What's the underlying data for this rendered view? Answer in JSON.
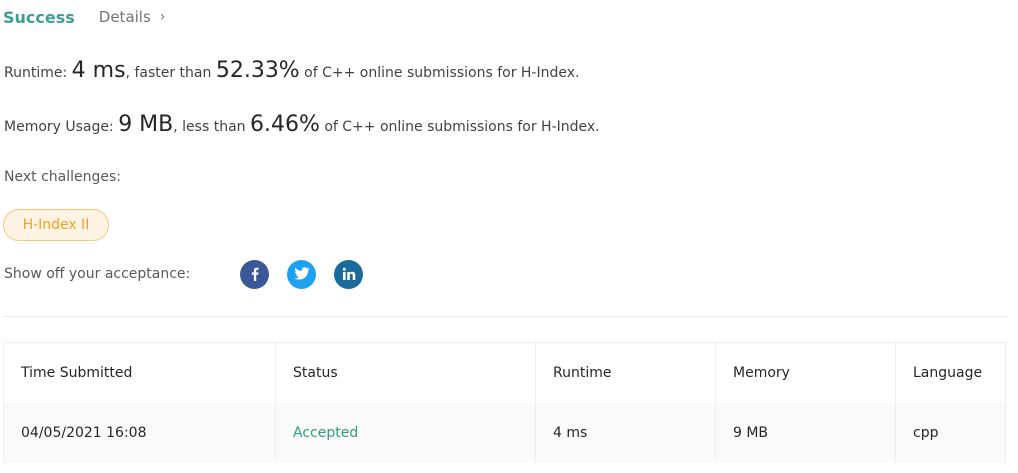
{
  "header": {
    "status": "Success",
    "details_label": "Details",
    "chevron": "›"
  },
  "runtime": {
    "label": "Runtime:",
    "value": "4 ms",
    "comparison": ", faster than",
    "percent": "52.33%",
    "suffix": "of C++ online submissions for H-Index."
  },
  "memory": {
    "label": "Memory Usage:",
    "value": "9 MB",
    "comparison": ", less than",
    "percent": "6.46%",
    "suffix": "of C++ online submissions for H-Index."
  },
  "next_challenges": {
    "label": "Next challenges:",
    "items": [
      "H-Index II"
    ]
  },
  "share": {
    "label": "Show off your acceptance:",
    "icons": [
      "facebook-icon",
      "twitter-icon",
      "linkedin-icon"
    ]
  },
  "table": {
    "headers": [
      "Time Submitted",
      "Status",
      "Runtime",
      "Memory",
      "Language"
    ],
    "rows": [
      [
        "04/05/2021 16:08",
        "Accepted",
        "4 ms",
        "9 MB",
        "cpp"
      ]
    ]
  },
  "colors": {
    "success": "#3c9f91",
    "accepted": "#2e9c7f",
    "tag_text": "#f0a028",
    "facebook": "#3b5998",
    "twitter": "#1da1f2",
    "linkedin": "#1a6a9c"
  }
}
